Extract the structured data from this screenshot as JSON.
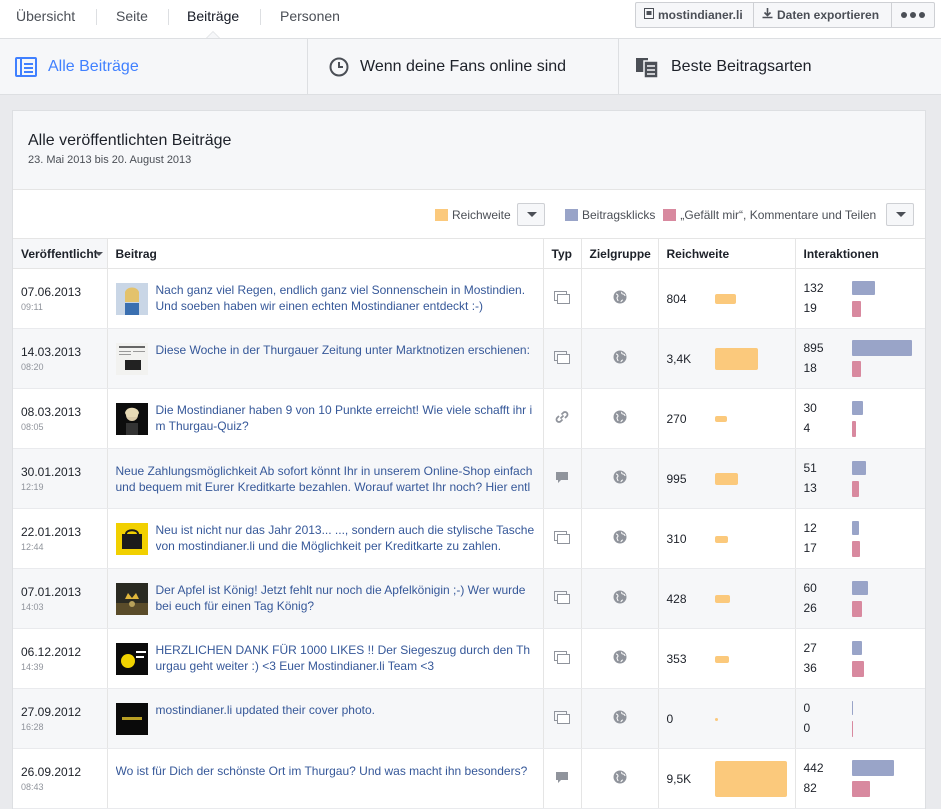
{
  "nav": {
    "tabs": [
      {
        "label": "Übersicht"
      },
      {
        "label": "Seite"
      },
      {
        "label": "Beiträge"
      },
      {
        "label": "Personen"
      }
    ],
    "page_button": "mostindianer.li",
    "export_button": "Daten exportieren"
  },
  "subnav": {
    "all_posts": "Alle Beiträge",
    "fans_online": "Wenn deine Fans online sind",
    "best_types": "Beste Beitragsarten"
  },
  "card": {
    "title": "Alle veröffentlichten Beiträge",
    "date_range": "23. Mai 2013 bis 20. August 2013"
  },
  "legend": {
    "reach": "Reichweite",
    "clicks": "Beitragsklicks",
    "likes": "„Gefällt mir“, Kommentare und Teilen"
  },
  "colors": {
    "accent": "#4080ff",
    "reach": "#fbc97c",
    "clicks": "#99a4c8",
    "likes": "#d8899f"
  },
  "columns": {
    "published": "Veröffentlicht",
    "post": "Beitrag",
    "type": "Typ",
    "audience": "Zielgruppe",
    "reach": "Reichweite",
    "interactions": "Interaktionen"
  },
  "rows": [
    {
      "date": "07.06.2013",
      "time": "09:11",
      "text": "Nach ganz viel Regen, endlich ganz viel Sonnenschein in Mostindien. Und soeben haben wir einen echten Mostindianer entdeckt :-)",
      "type_icon": "photo-icon",
      "reach": "804",
      "reach_num": 804,
      "clicks": "132",
      "clicks_num": 132,
      "likes": "19",
      "likes_num": 19,
      "thumb": "person-blonde"
    },
    {
      "date": "14.03.2013",
      "time": "08:20",
      "text": "Diese Woche in der Thurgauer Zeitung unter Marktnotizen erschienen:",
      "type_icon": "photo-icon",
      "reach": "3,4K",
      "reach_num": 3400,
      "clicks": "895",
      "clicks_num": 895,
      "likes": "18",
      "likes_num": 18,
      "thumb": "newspaper"
    },
    {
      "date": "08.03.2013",
      "time": "08:05",
      "text": "Die Mostindianer haben 9 von 10 Punkte erreicht! Wie viele schafft ihr im Thurgau-Quiz?",
      "type_icon": "link-icon",
      "reach": "270",
      "reach_num": 270,
      "clicks": "30",
      "clicks_num": 30,
      "likes": "4",
      "likes_num": 4,
      "thumb": "person-dark"
    },
    {
      "date": "30.01.2013",
      "time": "12:19",
      "text": "Neue Zahlungsmöglichkeit Ab sofort könnt Ihr in unserem Online-Shop einfach und bequem mit Eurer Kreditkarte bezahlen. Worauf wartet Ihr noch? Hier entl",
      "type_icon": "status-icon",
      "reach": "995",
      "reach_num": 995,
      "clicks": "51",
      "clicks_num": 51,
      "likes": "13",
      "likes_num": 13,
      "thumb": ""
    },
    {
      "date": "22.01.2013",
      "time": "12:44",
      "text": "Neu ist nicht nur das Jahr 2013... ..., sondern auch die stylische Tasche von mostindianer.li und die Möglichkeit per Kreditkarte zu zahlen.",
      "type_icon": "photo-icon",
      "reach": "310",
      "reach_num": 310,
      "clicks": "12",
      "clicks_num": 12,
      "likes": "17",
      "likes_num": 17,
      "thumb": "bag"
    },
    {
      "date": "07.01.2013",
      "time": "14:03",
      "text": "Der Apfel ist König! Jetzt fehlt nur noch die Apfelkönigin ;-) Wer wurde bei euch für einen Tag König?",
      "type_icon": "photo-icon",
      "reach": "428",
      "reach_num": 428,
      "clicks": "60",
      "clicks_num": 60,
      "likes": "26",
      "likes_num": 26,
      "thumb": "crown"
    },
    {
      "date": "06.12.2012",
      "time": "14:39",
      "text": "HERZLICHEN DANK FÜR 1000 LIKES !! Der Siegeszug durch den Thurgau geht weiter :) <3 Euer Mostindianer.li Team <3",
      "type_icon": "photo-icon",
      "reach": "353",
      "reach_num": 353,
      "clicks": "27",
      "clicks_num": 27,
      "likes": "36",
      "likes_num": 36,
      "thumb": "logo-yellow"
    },
    {
      "date": "27.09.2012",
      "time": "16:28",
      "text": "mostindianer.li updated their cover photo.",
      "type_icon": "photo-icon",
      "reach": "0",
      "reach_num": 0,
      "clicks": "0",
      "clicks_num": 0,
      "likes": "0",
      "likes_num": 0,
      "thumb": "cover-dark"
    },
    {
      "date": "26.09.2012",
      "time": "08:43",
      "text": "Wo ist für Dich der schönste Ort im Thurgau? Und was macht ihn besonders?",
      "type_icon": "status-icon",
      "reach": "9,5K",
      "reach_num": 9500,
      "clicks": "442",
      "clicks_num": 442,
      "likes": "82",
      "likes_num": 82,
      "thumb": ""
    }
  ]
}
